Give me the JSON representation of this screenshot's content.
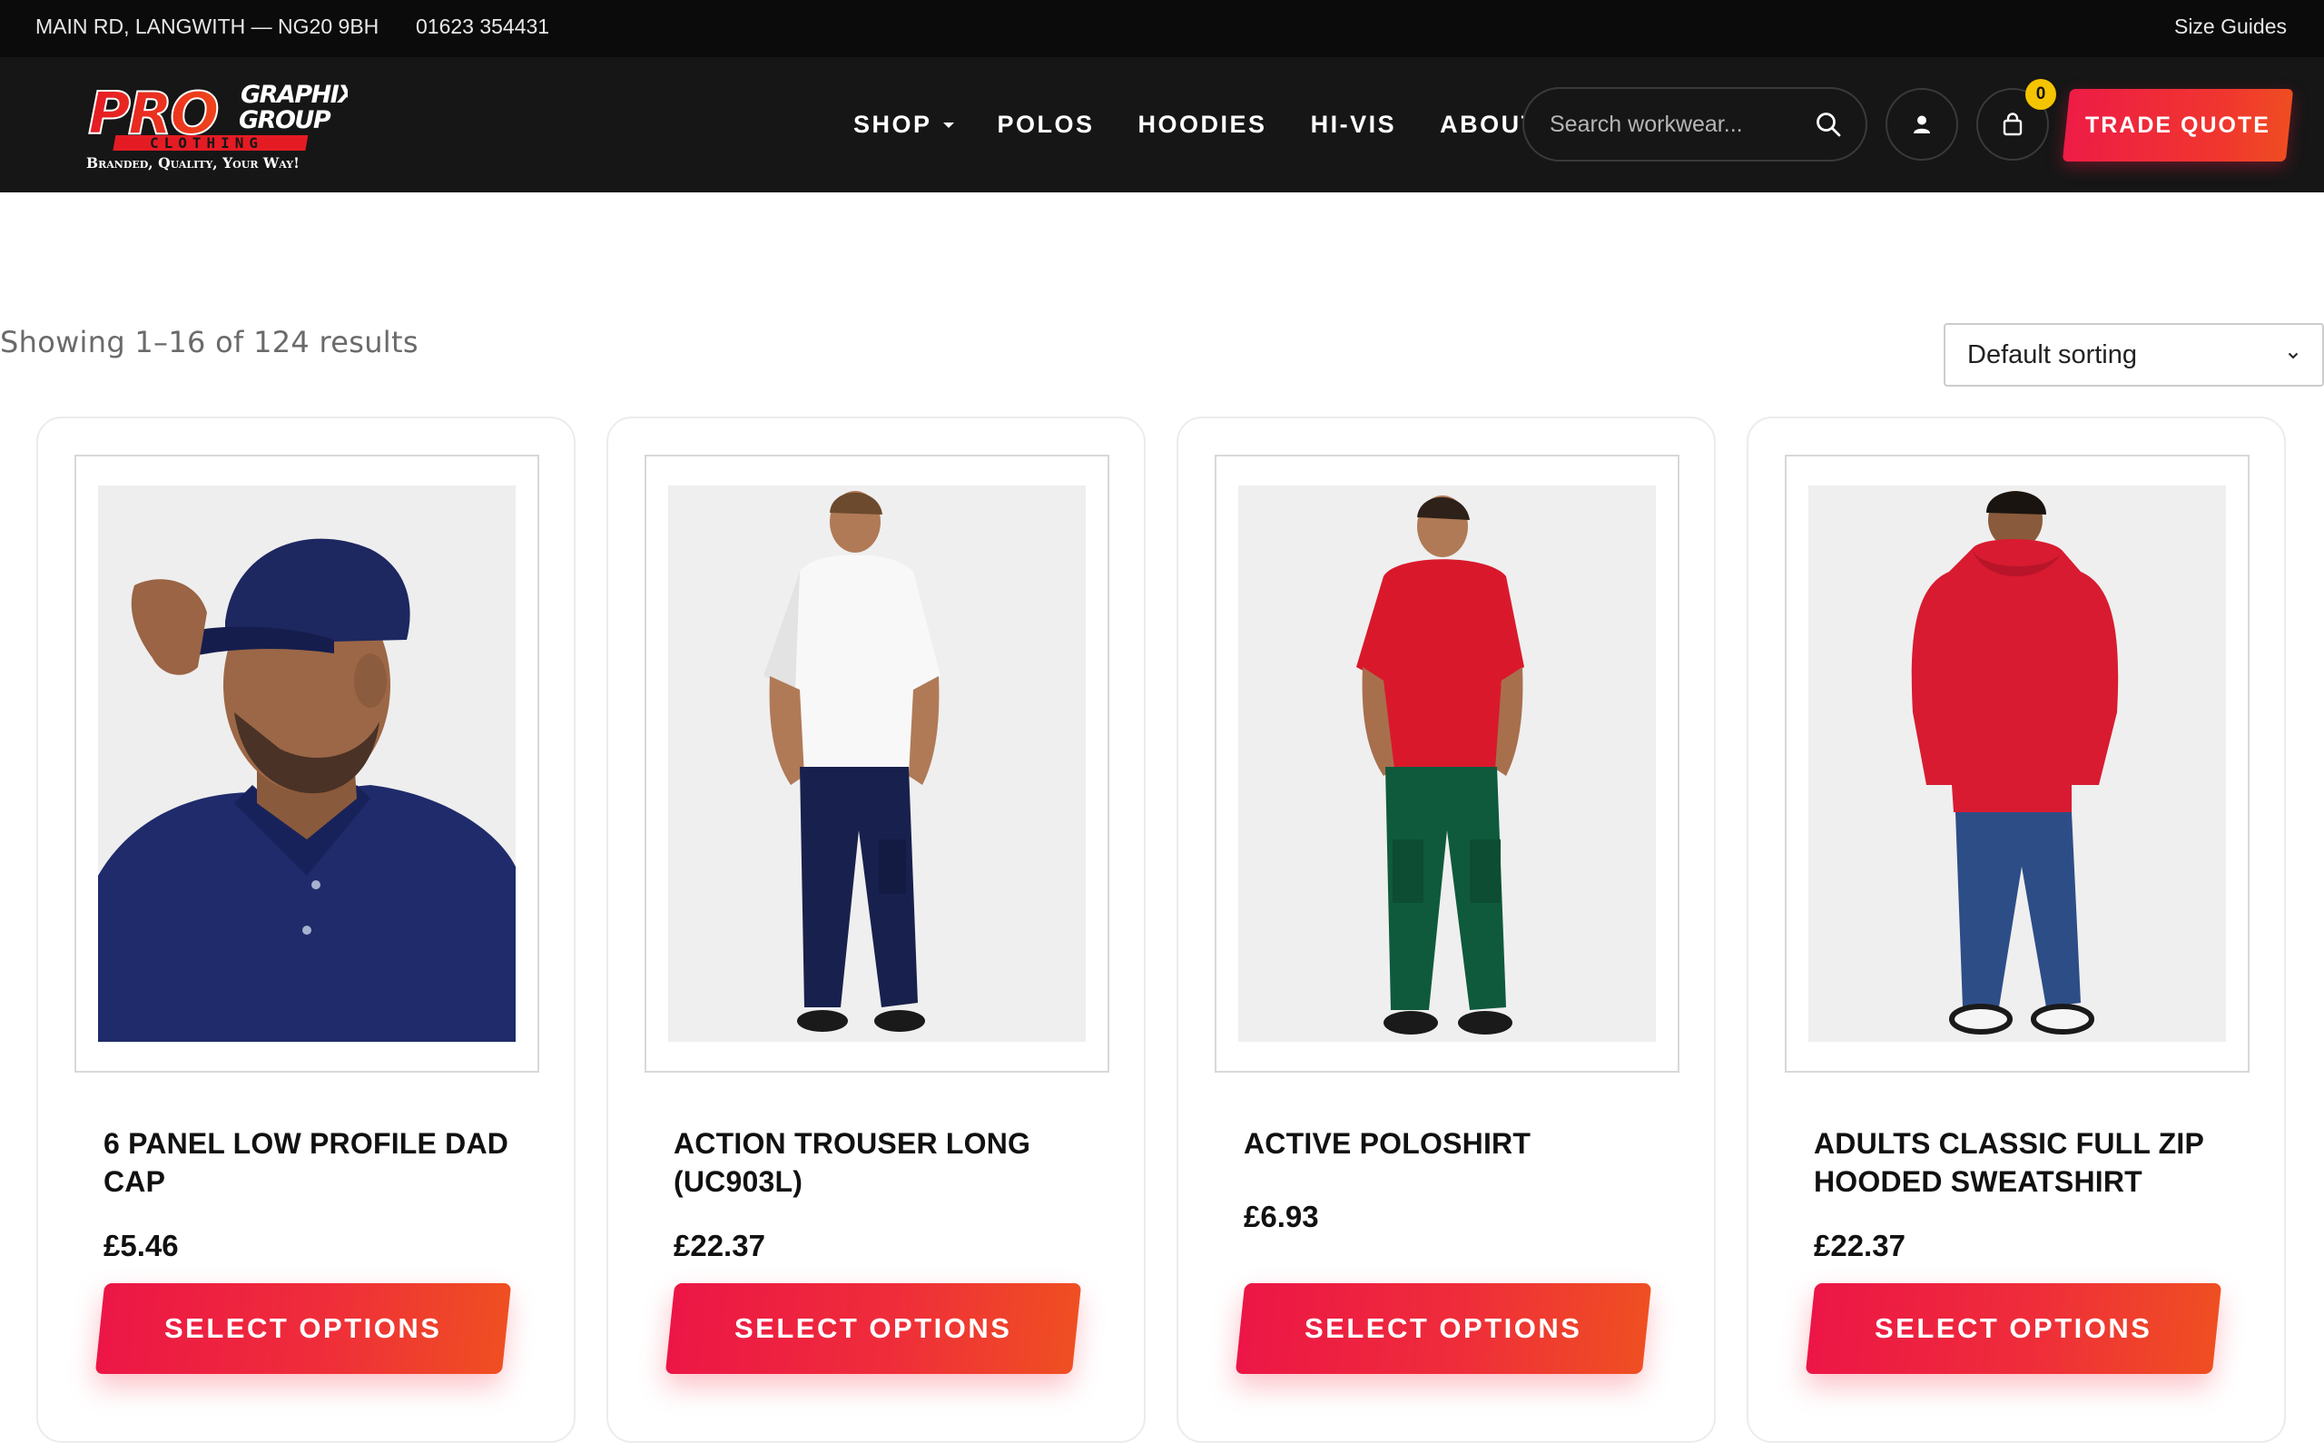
{
  "topbar": {
    "address": "MAIN RD, LANGWITH — NG20 9BH",
    "phone": "01623 354431",
    "size_guides": "Size Guides"
  },
  "logo": {
    "word_pro": "PRO",
    "word_graphix": "GRAPHIX",
    "word_group": "GROUP",
    "word_clothing": "CLOTHING",
    "tagline": "Branded, Quality, Your Way!"
  },
  "nav": {
    "items": [
      "SHOP",
      "POLOS",
      "HOODIES",
      "HI-VIS",
      "ABOUT"
    ]
  },
  "search": {
    "placeholder": "Search workwear..."
  },
  "cart": {
    "count": "0"
  },
  "trade_quote": "TRADE QUOTE",
  "toolbar": {
    "result_count": "Showing 1–16 of 124 results",
    "sorting": "Default sorting"
  },
  "products": [
    {
      "title": "6 PANEL LOW PROFILE DAD CAP",
      "price": "£5.46",
      "button": "SELECT OPTIONS"
    },
    {
      "title": "ACTION TROUSER LONG (UC903L)",
      "price": "£22.37",
      "button": "SELECT OPTIONS"
    },
    {
      "title": "ACTIVE POLOSHIRT",
      "price": "£6.93",
      "button": "SELECT OPTIONS"
    },
    {
      "title": "ADULTS CLASSIC FULL ZIP HOODED SWEATSHIRT",
      "price": "£22.37",
      "button": "SELECT OPTIONS"
    }
  ],
  "colors": {
    "accent_red": "#ee1c46",
    "accent_orange": "#ef4d22",
    "header_bg": "#161616",
    "topbar_bg": "#0b0b0b",
    "cart_badge": "#f5c400"
  }
}
